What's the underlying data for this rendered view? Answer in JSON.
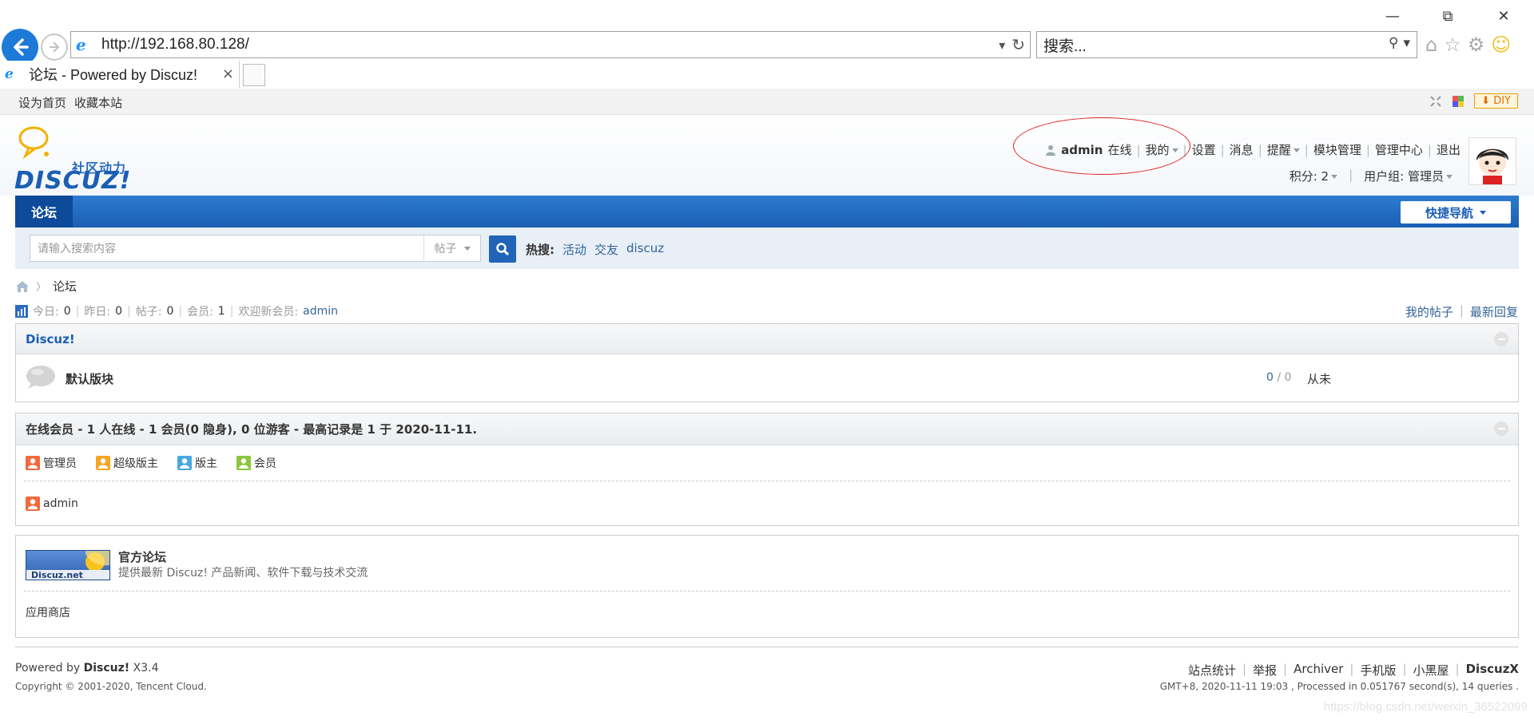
{
  "browser": {
    "url": "http://192.168.80.128/",
    "search_placeholder": "搜索...",
    "tab_title": "论坛 - Powered by Discuz!",
    "tab_close": "×"
  },
  "topbar": {
    "set_home": "设为首页",
    "bookmark": "收藏本站",
    "diy": "DIY"
  },
  "logo": {
    "tagline": "社区动力",
    "brand": "DISCUZ!"
  },
  "user": {
    "name": "admin",
    "status": "在线",
    "my": "我的",
    "settings": "设置",
    "messages": "消息",
    "notices": "提醒",
    "block_admin": "模块管理",
    "admin_center": "管理中心",
    "logout": "退出",
    "credits": "积分: 2",
    "group": "用户组: 管理员"
  },
  "nav": {
    "forum": "论坛",
    "quick_nav": "快捷导航"
  },
  "search": {
    "placeholder": "请输入搜索内容",
    "type": "帖子",
    "hot_label": "热搜:",
    "hot": [
      "活动",
      "交友",
      "discuz"
    ]
  },
  "breadcrumb": {
    "current": "论坛",
    "separator": "〉"
  },
  "stats": {
    "today_label": "今日:",
    "today": "0",
    "yesterday_label": "昨日:",
    "yesterday": "0",
    "posts_label": "帖子:",
    "posts": "0",
    "members_label": "会员:",
    "members": "1",
    "welcome_label": "欢迎新会员:",
    "newest": "admin",
    "my_posts": "我的帖子",
    "latest_replies": "最新回复"
  },
  "category": {
    "title": "Discuz!",
    "forum_name": "默认版块",
    "threads": "0",
    "posts": "0",
    "last_post": "从未"
  },
  "online": {
    "title": "在线会员 - 1 人在线 - 1 会员(0 隐身), 0 位游客 - 最高记录是 1 于 2020-11-11.",
    "legend": [
      "管理员",
      "超级版主",
      "版主",
      "会员"
    ],
    "users": [
      "admin"
    ]
  },
  "links": {
    "logo_text": "Discuz.net",
    "title": "官方论坛",
    "desc": "提供最新 Discuz! 产品新闻、软件下载与技术交流",
    "app_store": "应用商店"
  },
  "footer": {
    "powered_prefix": "Powered by",
    "powered_brand": "Discuz!",
    "version": "X3.4",
    "copyright": "Copyright © 2001-2020, Tencent Cloud.",
    "links": [
      "站点统计",
      "举报",
      "Archiver",
      "手机版",
      "小黑屋"
    ],
    "brand_right": "DiscuzX",
    "gmt": "GMT+8, 2020-11-11 19:03 , Processed in 0.051767 second(s), 14 queries ."
  },
  "watermark": "https://blog.csdn.net/weixin_36522099",
  "colors": {
    "nav_blue": "#1a5fb4",
    "link": "#336699",
    "annotation_red": "#e02020"
  }
}
